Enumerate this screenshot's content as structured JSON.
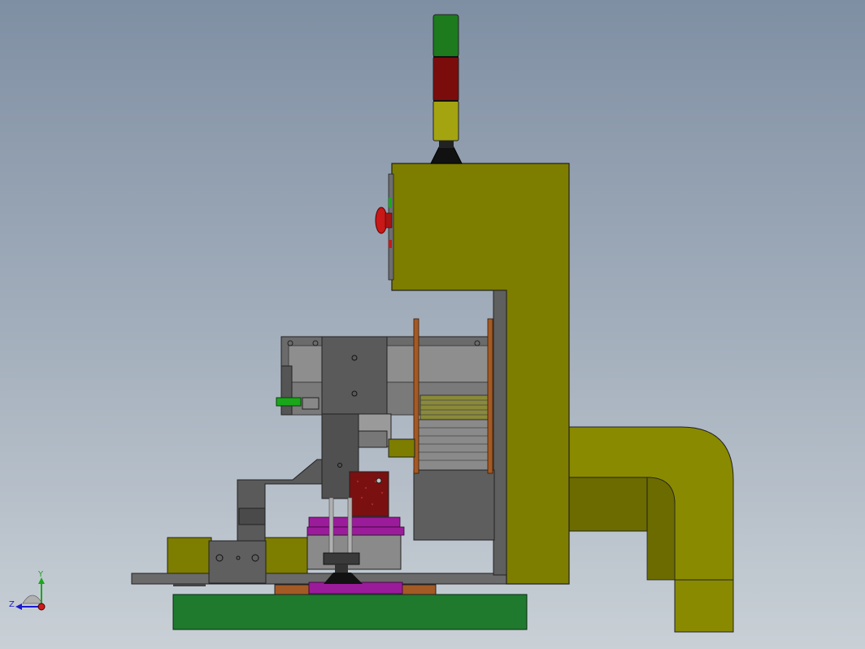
{
  "view": {
    "background_top": "#7f8fa3",
    "background_bottom": "#c9d0d6"
  },
  "triad": {
    "y_label": "Y",
    "z_label": "Z",
    "y_color": "#1aa81a",
    "z_color": "#1a1ad0",
    "x_color": "#d01a1a"
  },
  "colors": {
    "frame_olive": "#7d7d00",
    "frame_olive_dark": "#5f5f00",
    "duct_olive": "#8a8a00",
    "base_green": "#1f7a2e",
    "steel_grey": "#5f5f5f",
    "steel_light": "#8c8c8c",
    "purple": "#9b1c9b",
    "copper": "#a45a24",
    "dark_red": "#7a1010",
    "light_green": "#1d7a1d",
    "light_red": "#7a0c0c",
    "light_yellow": "#a4a410",
    "estop_red": "#c81818"
  }
}
